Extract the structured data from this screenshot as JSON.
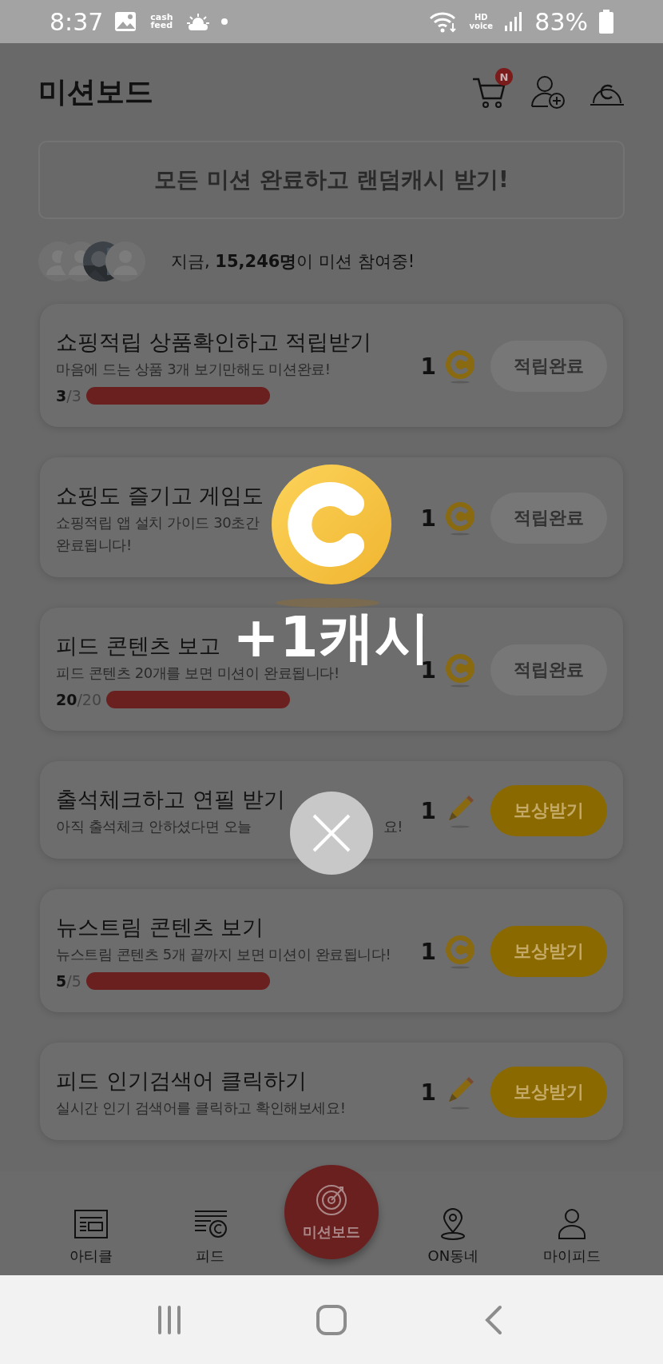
{
  "status_bar": {
    "time": "8:37",
    "app_logo": "cash feed",
    "network": "HD voice",
    "battery": "83%"
  },
  "header": {
    "title": "미션보드",
    "cart_badge": "N"
  },
  "banner": {
    "label": "모든 미션 완료하고 랜덤캐시 받기!"
  },
  "participants": {
    "text": "지금, **15,246명**이 미션 참여중!"
  },
  "missions": [
    {
      "title": "쇼핑적립 상품확인하고 적립받기",
      "description": "마음에 드는 상품 3개 보기만해도 미션완료!",
      "progress": "**3**/3",
      "amount": "1",
      "kind": "coin",
      "completed": true,
      "button": "적립완료"
    },
    {
      "title": "쇼핑도 즐기고 게임도",
      "description": "쇼핑적립 앱 설치 가이드 30초간",
      "description_line2": "완료됩니다!",
      "amount": "1",
      "kind": "coin",
      "completed": true,
      "button": "적립완료"
    },
    {
      "title": "피드 콘텐츠 보고",
      "description": "피드 콘텐츠 20개를 보면 미션이 완료됩니다!",
      "progress": "**20**/20",
      "amount": "1",
      "kind": "coin",
      "completed": true,
      "button": "적립완료"
    },
    {
      "title": "출석체크하고 연필 받기",
      "description": "아직 출석체크 안하셨다면 오늘",
      "description_tail": "요!",
      "amount": "1",
      "kind": "pencil",
      "completed": false,
      "button": "보상받기"
    },
    {
      "title": "뉴스트림 콘텐츠 보기",
      "description": "뉴스트림 콘텐츠 5개 끝까지 보면 미션이 완료됩니다!",
      "progress": "**5**/5",
      "amount": "1",
      "kind": "coin",
      "completed": false,
      "button": "보상받기"
    },
    {
      "title": "피드 인기검색어 클릭하기",
      "description": "실시간 인기 검색어를 클릭하고 확인해보세요!",
      "amount": "1",
      "kind": "pencil",
      "completed": false,
      "button": "보상받기"
    }
  ],
  "popup": {
    "message": "+1캐시"
  },
  "bottom_nav": [
    {
      "label": "아티클",
      "selected": false
    },
    {
      "label": "피드",
      "selected": false
    },
    {
      "label": "미션보드",
      "selected": true
    },
    {
      "label": "ON동네",
      "selected": false
    },
    {
      "label": "마이피드",
      "selected": false
    }
  ]
}
